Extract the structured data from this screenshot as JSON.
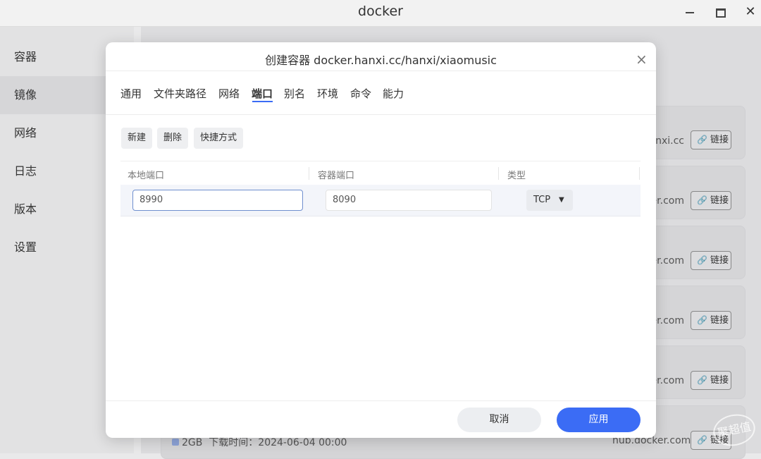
{
  "window": {
    "title": "docker",
    "minimize": "",
    "maximize": "",
    "close": "✕"
  },
  "sidebar": {
    "items": [
      {
        "label": "容器",
        "active": false
      },
      {
        "label": "镜像",
        "active": true
      },
      {
        "label": "网络",
        "active": false
      },
      {
        "label": "日志",
        "active": false
      },
      {
        "label": "版本",
        "active": false
      },
      {
        "label": "设置",
        "active": false
      }
    ]
  },
  "background_list": {
    "items": [
      {
        "domain": "anxi.cc",
        "link_label": "链接"
      },
      {
        "domain": "ker.com",
        "link_label": "链接"
      },
      {
        "domain": "ker.com",
        "link_label": "链接"
      },
      {
        "domain": "ker.com",
        "link_label": "链接"
      },
      {
        "domain": "ker.com",
        "link_label": "链接"
      }
    ],
    "bottom_item": {
      "size": "2GB",
      "download_time": "下载时间：2024-06-04 00:00",
      "domain": "hub.docker.com",
      "link_label": "链接"
    }
  },
  "watermark": "聚超值",
  "dialog": {
    "title": "创建容器 docker.hanxi.cc/hanxi/xiaomusic",
    "close_icon": "×",
    "tabs": [
      {
        "label": "通用"
      },
      {
        "label": "文件夹路径"
      },
      {
        "label": "网络"
      },
      {
        "label": "端口"
      },
      {
        "label": "别名"
      },
      {
        "label": "环境"
      },
      {
        "label": "命令"
      },
      {
        "label": "能力"
      }
    ],
    "active_tab": "端口",
    "toolbar": {
      "new": "新建",
      "delete": "删除",
      "shortcut": "快捷方式"
    },
    "table": {
      "headers": [
        "本地端口",
        "容器端口",
        "类型"
      ],
      "rows": [
        {
          "local_port": "8990",
          "required_mark": "*",
          "container_port": "8090",
          "type": "TCP"
        }
      ]
    },
    "footer": {
      "cancel": "取消",
      "apply": "应用"
    }
  },
  "colors": {
    "accent": "#3b6cf5",
    "required": "#e24a4a"
  }
}
